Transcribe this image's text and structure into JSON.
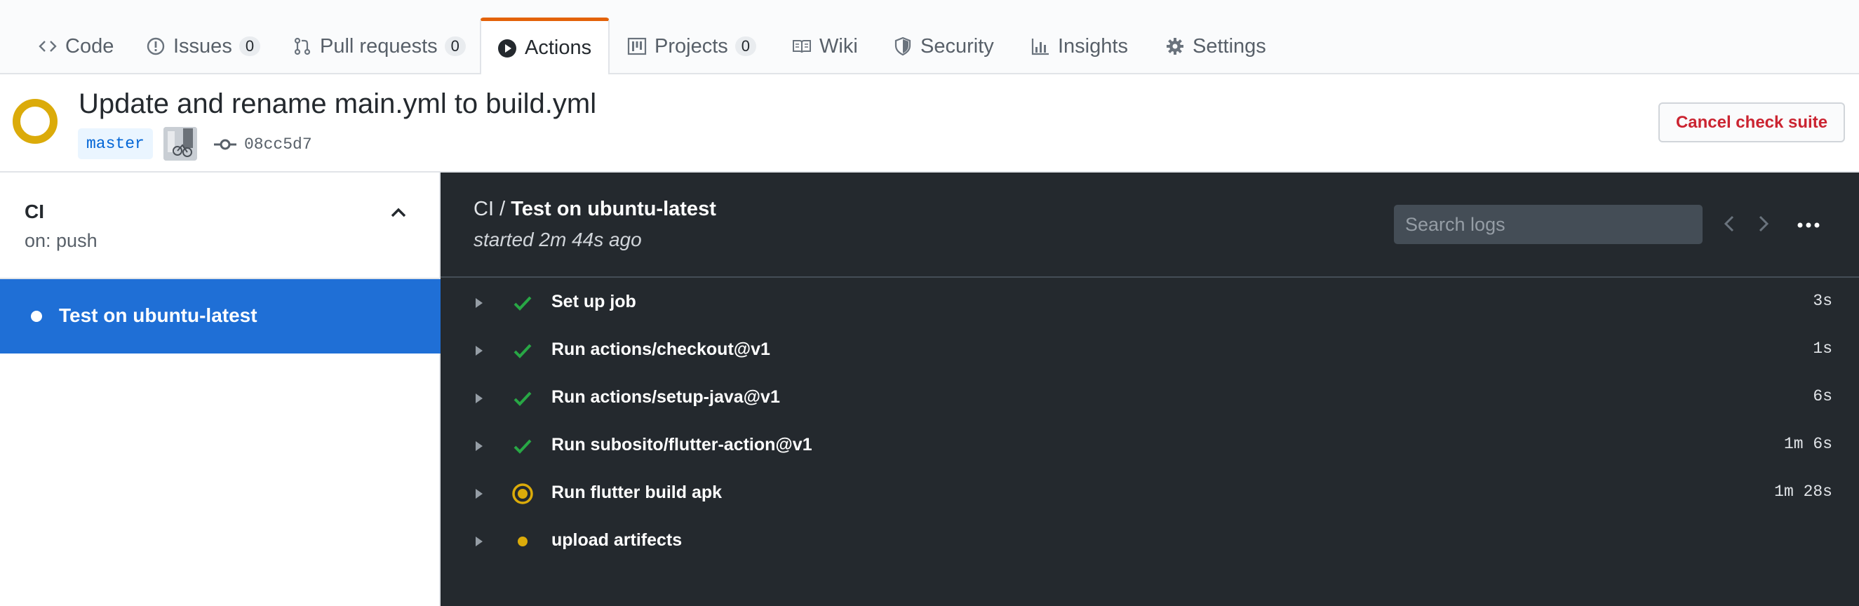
{
  "tabs": [
    {
      "label": "Code",
      "icon": "code-icon"
    },
    {
      "label": "Issues",
      "icon": "issue-icon",
      "count": "0"
    },
    {
      "label": "Pull requests",
      "icon": "pull-request-icon",
      "count": "0"
    },
    {
      "label": "Actions",
      "icon": "play-icon",
      "selected": true
    },
    {
      "label": "Projects",
      "icon": "project-icon",
      "count": "0"
    },
    {
      "label": "Wiki",
      "icon": "book-icon"
    },
    {
      "label": "Security",
      "icon": "shield-icon"
    },
    {
      "label": "Insights",
      "icon": "graph-icon"
    },
    {
      "label": "Settings",
      "icon": "gear-icon"
    }
  ],
  "header": {
    "title": "Update and rename main.yml to build.yml",
    "branch": "master",
    "commit_sha": "08cc5d7",
    "cancel_label": "Cancel check suite",
    "status": "in-progress"
  },
  "sidebar": {
    "workflow_name": "CI",
    "workflow_trigger": "on: push",
    "jobs": [
      {
        "label": "Test on ubuntu-latest",
        "selected": true
      }
    ]
  },
  "log": {
    "workflow": "CI",
    "separator": "/",
    "job": "Test on ubuntu-latest",
    "started": "started 2m 44s ago",
    "search_placeholder": "Search logs",
    "steps": [
      {
        "name": "Set up job",
        "status": "success",
        "duration": "3s"
      },
      {
        "name": "Run actions/checkout@v1",
        "status": "success",
        "duration": "1s"
      },
      {
        "name": "Run actions/setup-java@v1",
        "status": "success",
        "duration": "6s"
      },
      {
        "name": "Run subosito/flutter-action@v1",
        "status": "success",
        "duration": "1m 6s"
      },
      {
        "name": "Run flutter build apk",
        "status": "in-progress",
        "duration": "1m 28s"
      },
      {
        "name": "upload artifects",
        "status": "queued",
        "duration": ""
      }
    ]
  },
  "colors": {
    "accent_tab": "#e36209",
    "in_progress": "#dbab0a",
    "success": "#28a745",
    "selected_job": "#1f6fd6",
    "cancel_text": "#cb2431"
  }
}
